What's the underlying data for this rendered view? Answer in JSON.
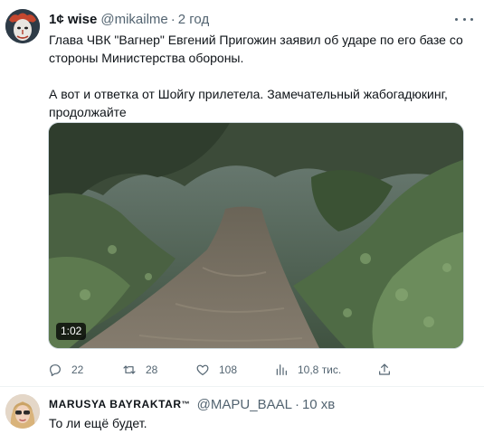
{
  "tweet1": {
    "author": {
      "display_name": "1¢ wise",
      "handle": "@mikailme"
    },
    "time": "2 год",
    "dot": "·",
    "text_lines": [
      "Глава ЧВК \"Вагнер\" Евгений Пригожин заявил об ударе по его базе со",
      "стороны Министерства обороны.",
      "А вот и ответка от Шойгу прилетела. Замечательный жабогадюкинг,",
      "продолжайте"
    ],
    "video": {
      "duration": "1:02"
    },
    "actions": {
      "replies": "22",
      "retweets": "28",
      "likes": "108",
      "views": "10,8 тис.",
      "icons": [
        "reply-icon",
        "retweet-icon",
        "like-icon",
        "views-icon",
        "share-icon"
      ]
    }
  },
  "tweet2": {
    "author": {
      "display_name": "MARUSYA BAYRAKTAR",
      "badge": "™",
      "handle": "@MAPU_BAAL"
    },
    "time": "10 хв",
    "dot": "·",
    "text": "То ли ещё будет."
  },
  "colors": {
    "text": "#0f1419",
    "secondary": "#536471",
    "divider": "#eff3f4",
    "background": "#ffffff"
  }
}
